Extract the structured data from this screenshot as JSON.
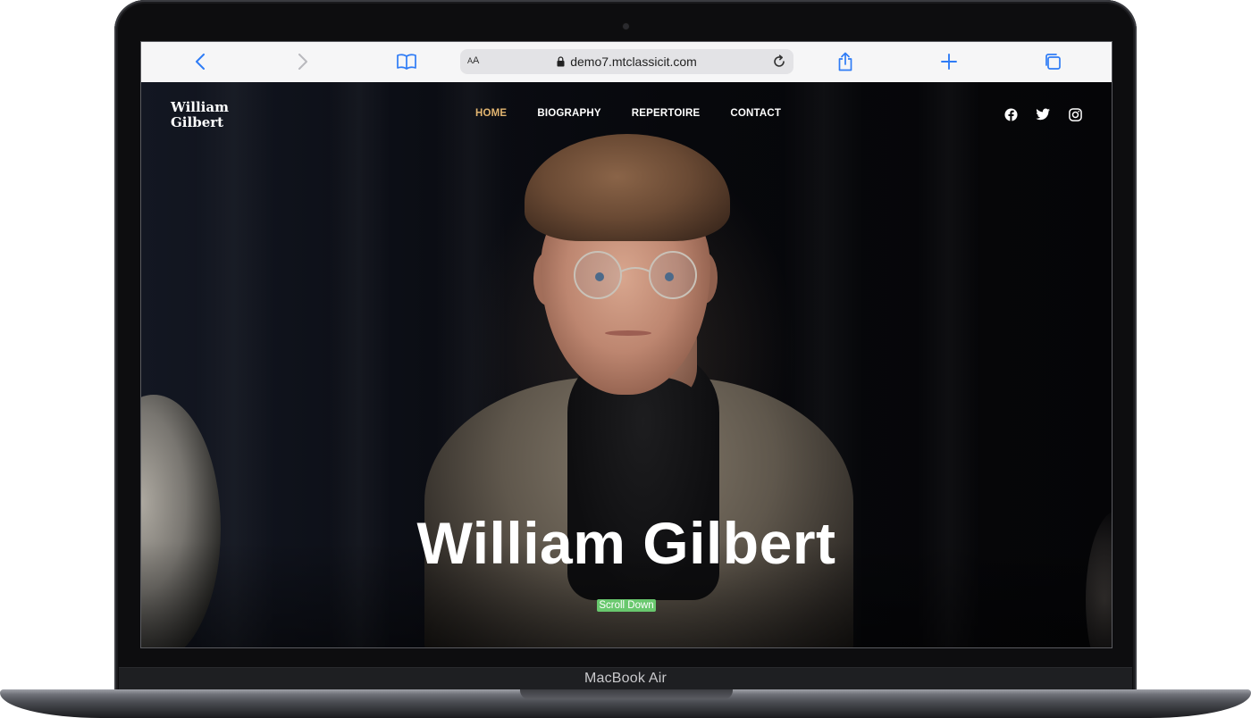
{
  "device": {
    "model_label": "MacBook Air"
  },
  "browser": {
    "url": "demo7.mtclassicit.com",
    "text_size_label": {
      "small": "A",
      "large": "A"
    },
    "icons": [
      "back-icon",
      "forward-icon",
      "bookmarks-icon",
      "lock-icon",
      "reload-icon",
      "share-icon",
      "new-tab-icon",
      "tabs-icon"
    ]
  },
  "site": {
    "logo": {
      "line1": "William",
      "line2": "Gilbert"
    },
    "nav": [
      {
        "label": "HOME",
        "active": true
      },
      {
        "label": "BIOGRAPHY",
        "active": false
      },
      {
        "label": "REPERTOIRE",
        "active": false
      },
      {
        "label": "CONTACT",
        "active": false
      }
    ],
    "social": [
      "facebook-icon",
      "twitter-icon",
      "instagram-icon"
    ],
    "hero": {
      "title": "William Gilbert",
      "scroll_label": "Scroll Down"
    },
    "colors": {
      "nav_active": "#e2b570",
      "scroll_button": "#69c86e"
    }
  }
}
